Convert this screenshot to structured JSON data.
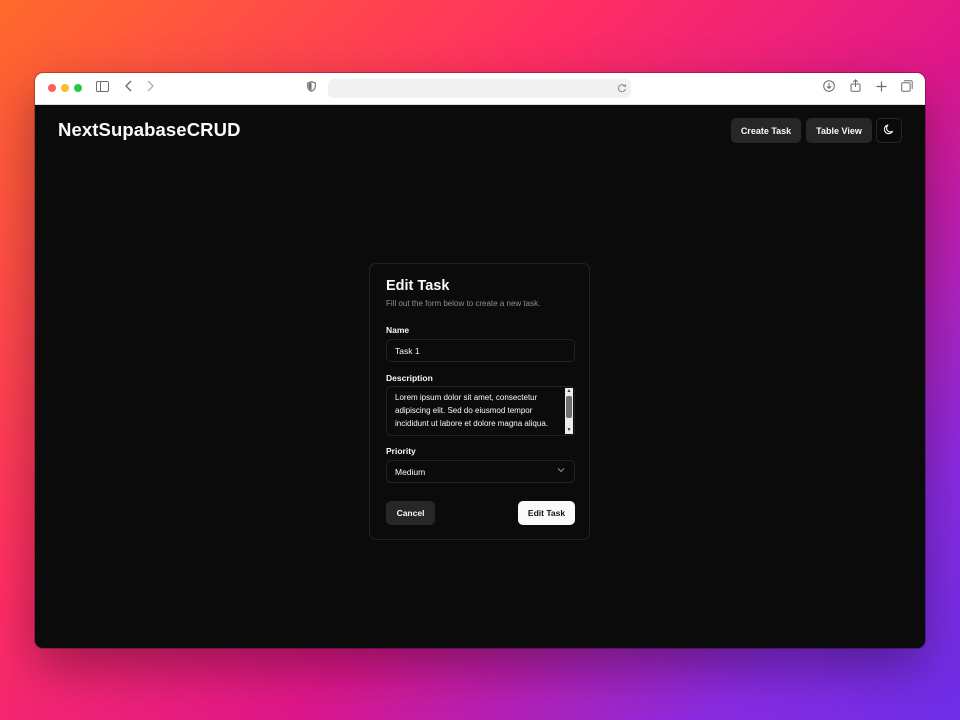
{
  "app": {
    "brand": "NextSupabaseCRUD"
  },
  "header": {
    "create_label": "Create Task",
    "table_label": "Table View",
    "theme_icon": "moon-icon"
  },
  "form": {
    "title": "Edit Task",
    "subtitle": "Fill out the form below to create a new task.",
    "name_label": "Name",
    "name_value": "Task 1",
    "description_label": "Description",
    "description_value": "Lorem ipsum dolor sit amet, consectetur adipiscing elit. Sed do eiusmod tempor incididunt ut labore et dolore magna aliqua.",
    "priority_label": "Priority",
    "priority_value": "Medium",
    "cancel_label": "Cancel",
    "submit_label": "Edit Task"
  },
  "colors": {
    "background": "#0b0b0c",
    "card_border": "#232326",
    "secondary_button": "#27272a",
    "primary_button": "#fafafa",
    "muted_text": "#8f8f96"
  },
  "browser_icons": [
    "sidebar-icon",
    "back-icon",
    "forward-icon",
    "shield-icon",
    "reload-icon",
    "download-icon",
    "share-icon",
    "new-tab-icon",
    "tabs-overview-icon"
  ]
}
